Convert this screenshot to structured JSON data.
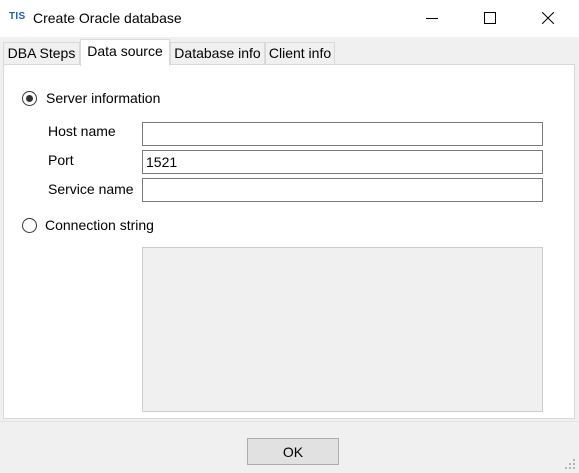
{
  "window": {
    "app_logo": "TIS",
    "title": "Create Oracle database"
  },
  "tabs": [
    {
      "label": "DBA Steps",
      "active": false
    },
    {
      "label": "Data source",
      "active": true
    },
    {
      "label": "Database info",
      "active": false
    },
    {
      "label": "Client info",
      "active": false
    }
  ],
  "data_source": {
    "server_info": {
      "label": "Server information",
      "selected": true
    },
    "host_name": {
      "label": "Host name",
      "value": ""
    },
    "port": {
      "label": "Port",
      "value": "1521"
    },
    "service_name": {
      "label": "Service name",
      "value": ""
    },
    "connection_string": {
      "label": "Connection string",
      "selected": false,
      "value": ""
    }
  },
  "footer": {
    "ok_label": "OK"
  },
  "colors": {
    "logo": "#1e5fa8",
    "window_bg": "#f0f0f0",
    "panel_bg": "#ffffff",
    "button_bg": "#e1e1e1"
  },
  "icons": [
    "minimize-icon",
    "maximize-icon",
    "close-icon",
    "resize-grip-icon"
  ]
}
